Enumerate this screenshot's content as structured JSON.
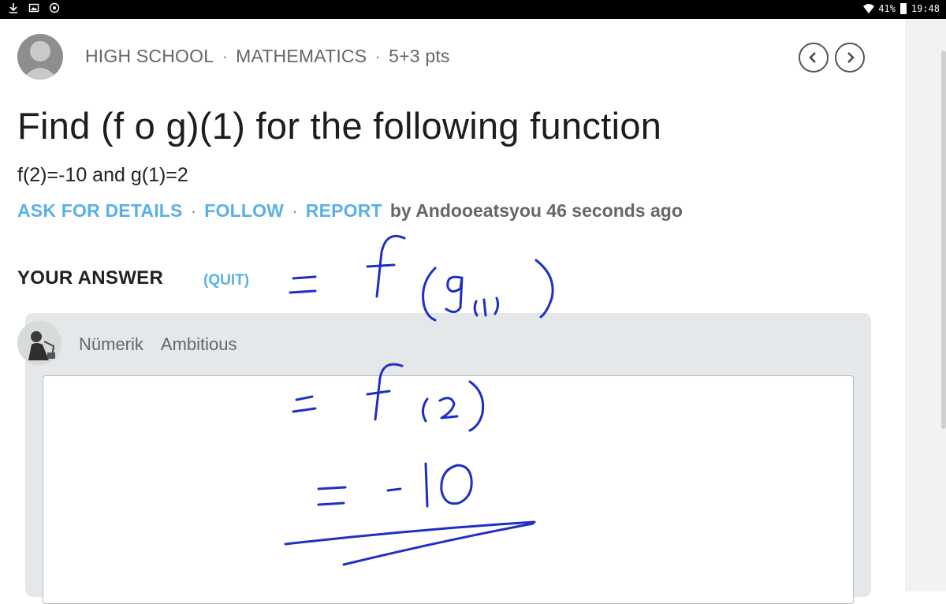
{
  "status_bar": {
    "battery": "41%",
    "time": "19:48",
    "icons": [
      "download-icon",
      "image-icon",
      "record-icon",
      "wifi-icon",
      "battery-icon"
    ]
  },
  "question": {
    "level": "HIGH SCHOOL",
    "subject": "MATHEMATICS",
    "points": "5+3 pts",
    "title": "Find (f o g)(1) for the following function",
    "body": "f(2)=-10 and g(1)=2",
    "actions": {
      "ask_details": "ASK FOR DETAILS",
      "follow": "FOLLOW",
      "report": "REPORT",
      "by_text": "by Andooeatsyou 46 seconds ago"
    }
  },
  "answer": {
    "heading": "YOUR ANSWER",
    "quit": "(QUIT)",
    "user_name": "Nümerik",
    "user_rank": "Ambitious",
    "editor_value": ""
  },
  "handwriting": {
    "lines": [
      "= f(g(1))",
      "= f(2)",
      "= -10"
    ],
    "ink_color": "#1f2fc4"
  },
  "colors": {
    "link": "#5ab0e6",
    "panel": "#e4e8eb",
    "statusbar": "#000000"
  }
}
